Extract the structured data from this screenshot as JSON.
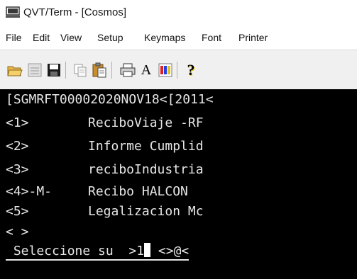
{
  "window": {
    "title": "QVT/Term - [Cosmos]"
  },
  "menu": [
    {
      "label": "File"
    },
    {
      "label": "Edit"
    },
    {
      "label": "View"
    },
    {
      "label": "Setup"
    },
    {
      "label": "Keymaps"
    },
    {
      "label": "Font"
    },
    {
      "label": "Printer"
    }
  ],
  "toolbar": {
    "buttons": [
      {
        "icon": "open-folder-icon"
      },
      {
        "icon": "grid-icon"
      },
      {
        "icon": "save-icon"
      },
      {
        "icon": "copy-icon"
      },
      {
        "icon": "paste-icon"
      },
      {
        "icon": "print-icon"
      },
      {
        "icon": "font-icon",
        "label": "A"
      },
      {
        "icon": "colors-icon"
      },
      {
        "icon": "help-icon",
        "label": "?"
      }
    ]
  },
  "terminal": {
    "header": "[SGMRFT00002020NOV18<[2011<",
    "options": [
      {
        "key": "<1>",
        "label": "ReciboViaje -RF"
      },
      {
        "key": "<2>",
        "label": "Informe Cumplid"
      },
      {
        "key": "<3>",
        "label": "reciboIndustria"
      },
      {
        "key": "<4>-M-",
        "label": "Recibo HALCON"
      },
      {
        "key": "<5>",
        "label": "Legalizacion Mc"
      },
      {
        "key": "< >",
        "label": ""
      }
    ],
    "prompt_label": " Seleccione su  >",
    "prompt_value": "1",
    "prompt_tail": " <>@<"
  }
}
